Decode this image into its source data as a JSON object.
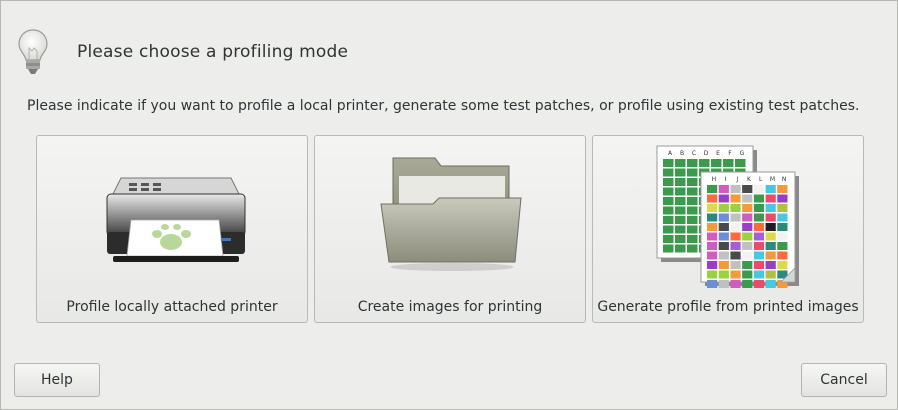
{
  "header": {
    "title": "Please choose a profiling mode",
    "icon": "lightbulb-icon"
  },
  "description": "Please indicate if you want to profile a local printer, generate some test patches, or profile using existing test patches.",
  "choices": [
    {
      "label": "Profile locally attached printer",
      "icon": "printer-icon"
    },
    {
      "label": "Create images for printing",
      "icon": "folder-icon"
    },
    {
      "label": "Generate profile from printed images",
      "icon": "color-patches-icon"
    }
  ],
  "patch_headers_back": [
    "A",
    "B",
    "C",
    "D",
    "E",
    "F",
    "G"
  ],
  "patch_headers_front": [
    "H",
    "I",
    "J",
    "K",
    "L",
    "M",
    "N"
  ],
  "buttons": {
    "help": "Help",
    "cancel": "Cancel"
  }
}
